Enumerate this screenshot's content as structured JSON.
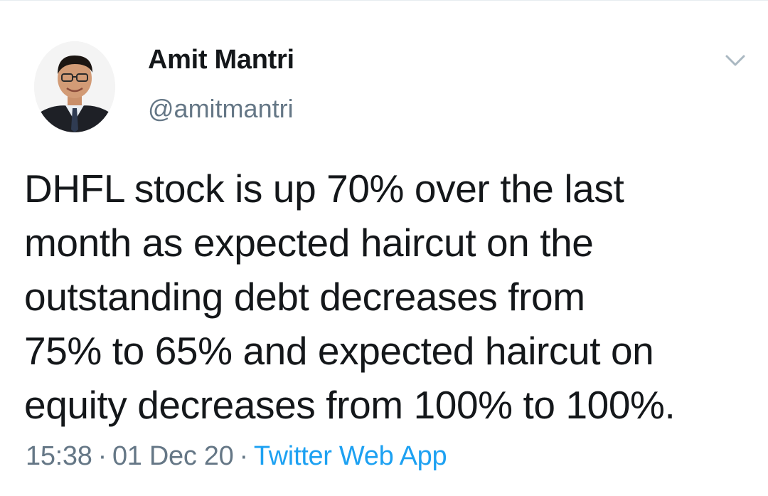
{
  "author": {
    "display_name": "Amit Mantri",
    "handle": "@amitmantri",
    "avatar_icon": "profile-photo"
  },
  "tweet": {
    "lines": [
      "DHFL stock is up 70% over the last",
      "month as expected haircut on the",
      "outstanding debt decreases from",
      "75% to 65% and expected haircut on",
      "equity decreases from 100% to 100%."
    ]
  },
  "meta": {
    "time": "15:38",
    "date": "01 Dec 20",
    "separator": "·",
    "source": "Twitter Web App"
  },
  "colors": {
    "text": "#14171a",
    "secondary": "#657786",
    "link": "#1da1f2"
  },
  "icons": {
    "menu": "chevron-down-icon"
  }
}
